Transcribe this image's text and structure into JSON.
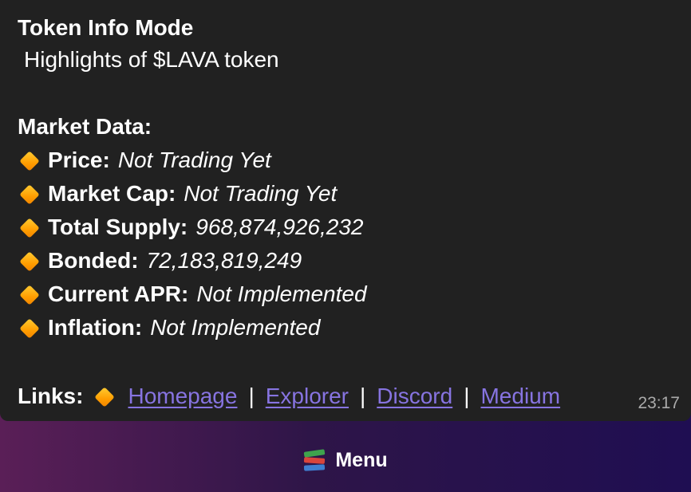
{
  "message": {
    "title": "Token Info Mode",
    "subtitle": "Highlights of $LAVA token",
    "section_heading": "Market Data:",
    "items": [
      {
        "label": "Price:",
        "value": "Not Trading Yet"
      },
      {
        "label": "Market Cap:",
        "value": "Not Trading Yet"
      },
      {
        "label": "Total Supply:",
        "value": "968,874,926,232"
      },
      {
        "label": "Bonded:",
        "value": "72,183,819,249"
      },
      {
        "label": "Current APR:",
        "value": "Not Implemented"
      },
      {
        "label": "Inflation:",
        "value": "Not Implemented"
      }
    ],
    "links_label": "Links:",
    "links": [
      "Homepage",
      "Explorer",
      "Discord",
      "Medium"
    ],
    "separator": "|",
    "time": "23:17",
    "bullet_icon": "orange-diamond-icon"
  },
  "keyboard": {
    "menu_label": "Menu",
    "menu_icon": "books-icon"
  },
  "colors": {
    "bubble": "#212121",
    "link": "#8774e1",
    "diamond": "#ff9d00"
  }
}
